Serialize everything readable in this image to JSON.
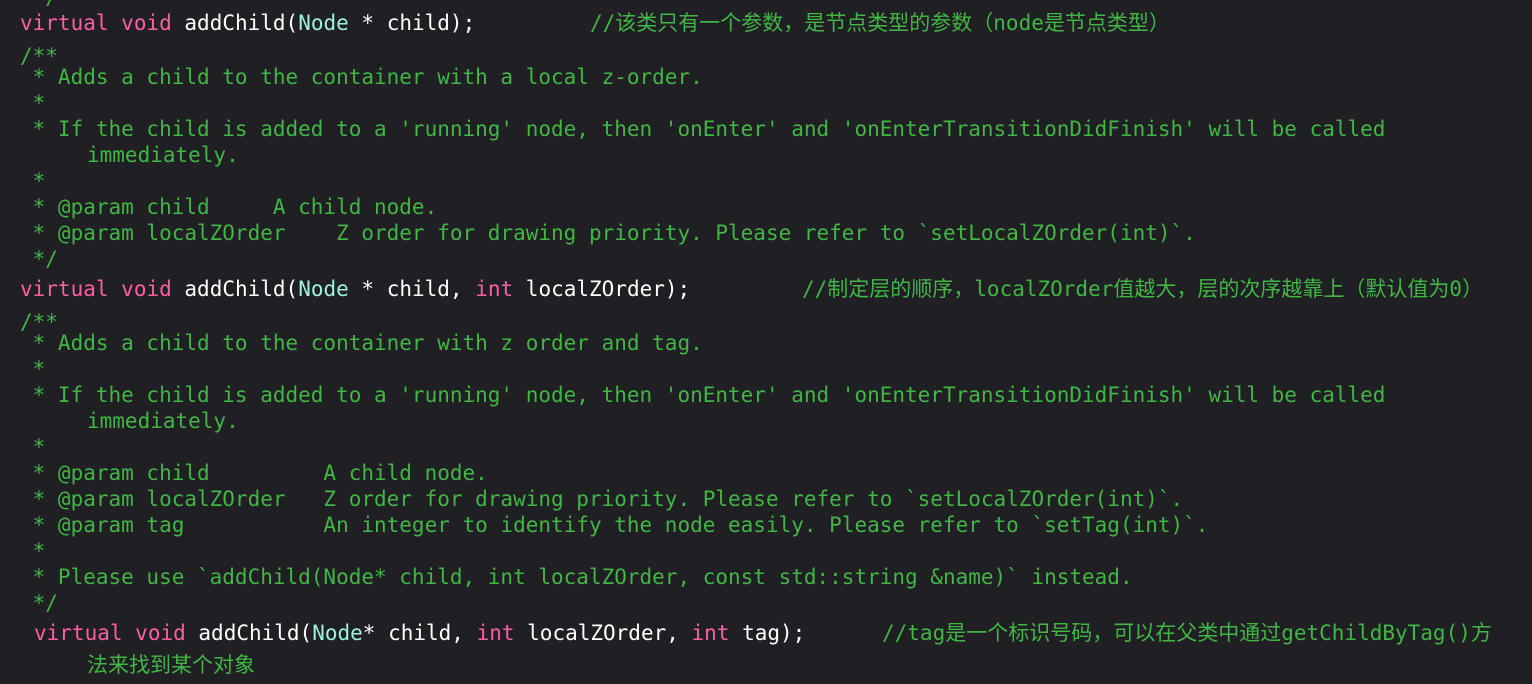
{
  "colors": {
    "background": "#1f1f24",
    "keyword": "#fc5fa3",
    "type": "#9ef1dd",
    "plain": "#ffffff",
    "comment": "#41b645"
  },
  "code": {
    "top_fragment": " */",
    "decl1": {
      "kw1": "virtual",
      "kw2": "void",
      "fn_open": "addChild(",
      "type": "Node",
      "rest": " * child);",
      "comment": "//该类只有一个参数，是节点类型的参数（node是节点类型）"
    },
    "doc1": {
      "open": "/**",
      "l1": " * Adds a child to the container with a local z-order.",
      "l2": " *",
      "l3": " * If the child is added to a 'running' node, then 'onEnter' and 'onEnterTransitionDidFinish' will be called",
      "l3b": "immediately.",
      "l4": " *",
      "l5": " * @param child     A child node.",
      "l6": " * @param localZOrder    Z order for drawing priority. Please refer to `setLocalZOrder(int)`.",
      "close": " */"
    },
    "decl2": {
      "kw1": "virtual",
      "kw2": "void",
      "fn_open": "addChild(",
      "type": "Node",
      "rest1": " * child, ",
      "kw3": "int",
      "rest2": " localZOrder);",
      "comment": "//制定层的顺序，localZOrder值越大，层的次序越靠上（默认值为0）"
    },
    "doc2": {
      "open": "/**",
      "l1": " * Adds a child to the container with z order and tag.",
      "l2": " *",
      "l3": " * If the child is added to a 'running' node, then 'onEnter' and 'onEnterTransitionDidFinish' will be called",
      "l3b": "immediately.",
      "l4": " *",
      "l5": " * @param child         A child node.",
      "l6": " * @param localZOrder   Z order for drawing priority. Please refer to `setLocalZOrder(int)`.",
      "l7": " * @param tag           An integer to identify the node easily. Please refer to `setTag(int)`.",
      "l8": " *",
      "l9": " * Please use `addChild(Node* child, int localZOrder, const std::string &name)` instead.",
      "close": " */"
    },
    "decl3": {
      "kw1": "virtual",
      "kw2": "void",
      "fn_open": "addChild(",
      "type": "Node",
      "rest1": "* child, ",
      "kw3": "int",
      "rest2": " localZOrder, ",
      "kw4": "int",
      "rest3": " tag);",
      "comment": "//tag是一个标识号码，可以在父类中通过getChildByTag()方",
      "comment_cont": "法来找到某个对象"
    }
  }
}
